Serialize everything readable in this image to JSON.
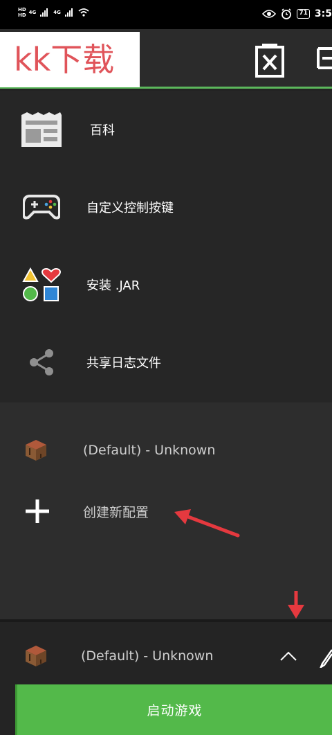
{
  "status_bar": {
    "hd1": "HD",
    "hd2": "HD",
    "net1": "4G",
    "net2": "4G",
    "battery": "71",
    "time": "3:5"
  },
  "toolbar": {
    "logo_text": "kk下载"
  },
  "menu": {
    "items": [
      {
        "label": "百科",
        "icon": "wiki-news-icon"
      },
      {
        "label": "自定义控制按键",
        "icon": "gamepad-icon"
      },
      {
        "label": "安装 .JAR",
        "icon": "shapes-icon"
      },
      {
        "label": "共享日志文件",
        "icon": "share-icon"
      }
    ]
  },
  "profiles": {
    "default_label": "(Default) - Unknown",
    "create_label": "创建新配置"
  },
  "bottom": {
    "selected_profile": "(Default) - Unknown",
    "launch_label": "启动游戏"
  },
  "colors": {
    "accent_green": "#53b94a",
    "annotation_red": "#e5393f",
    "logo_red": "#e0545a"
  }
}
